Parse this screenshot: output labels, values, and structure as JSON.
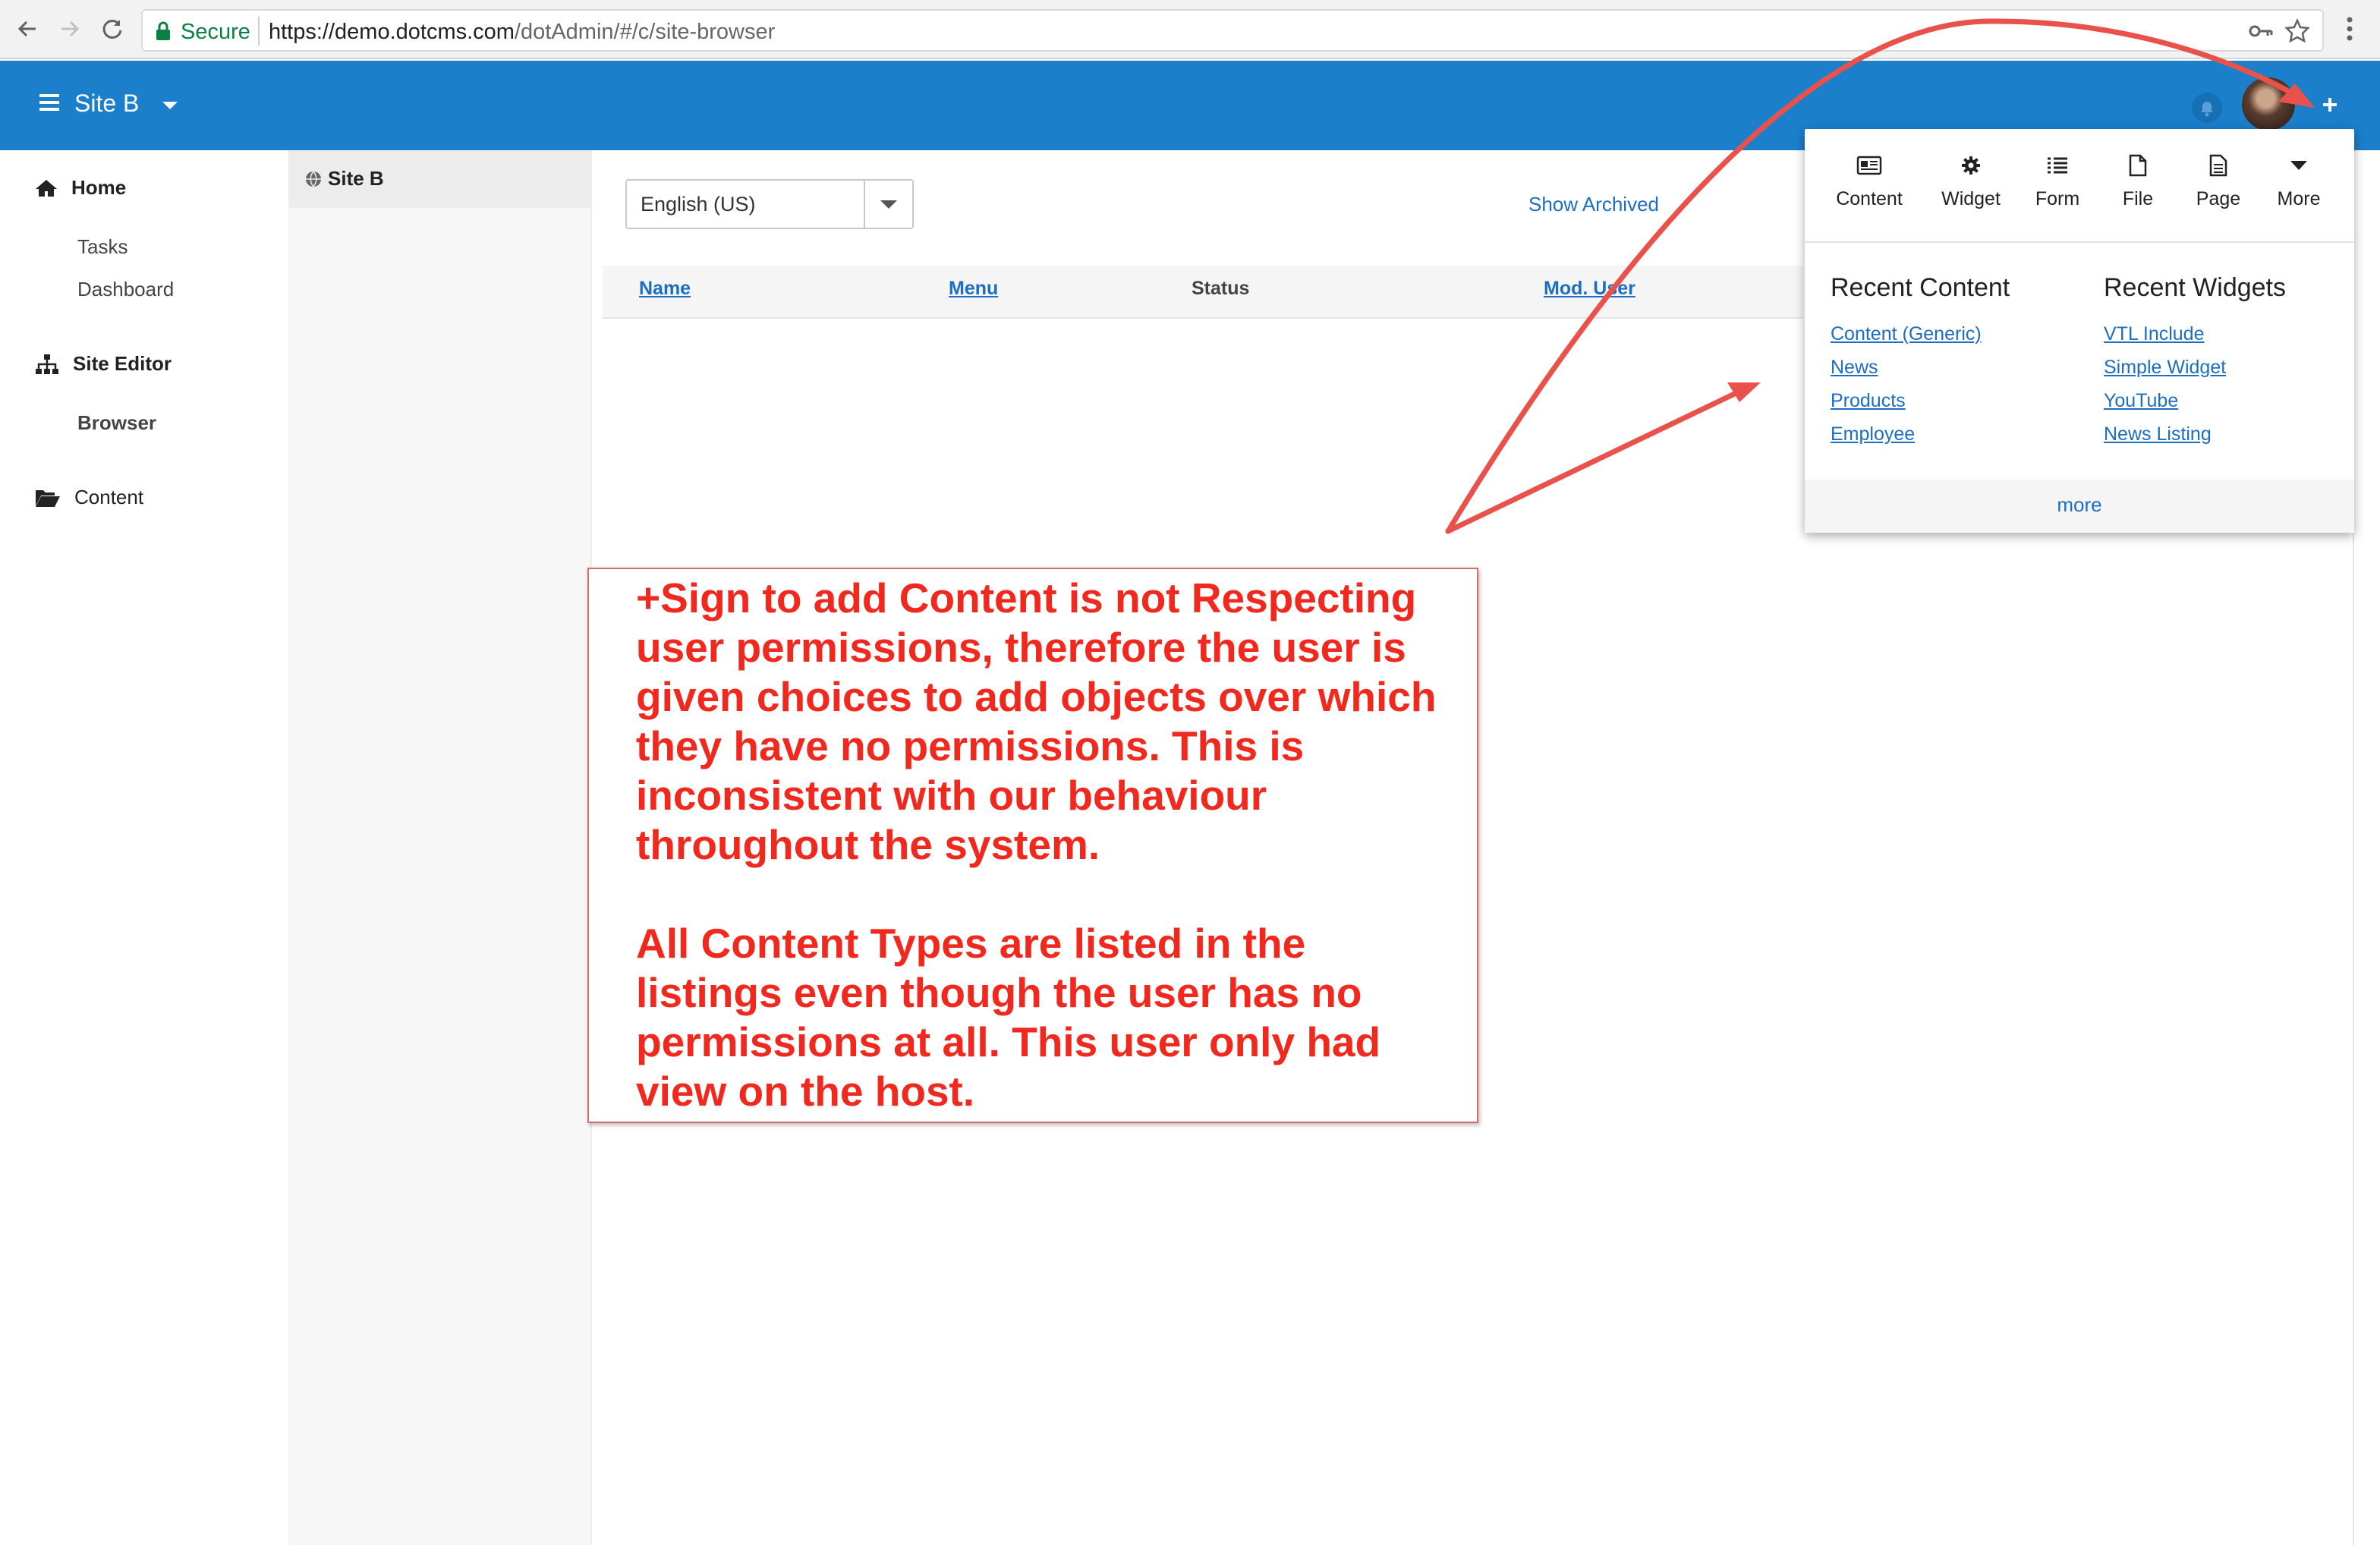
{
  "browser": {
    "secure_label": "Secure",
    "url_host": "https://demo.dotcms.com",
    "url_path": "/dotAdmin/#/c/site-browser"
  },
  "header": {
    "site_name": "Site B"
  },
  "leftnav": {
    "sections": [
      {
        "label": "Home",
        "icon": "home-icon",
        "items": [
          "Tasks",
          "Dashboard"
        ]
      },
      {
        "label": "Site Editor",
        "icon": "sitemap-icon",
        "items": [
          "Browser"
        ]
      },
      {
        "label": "Content",
        "icon": "folder-open-icon",
        "items": []
      }
    ]
  },
  "tree": {
    "root_label": "Site B"
  },
  "browser_panel": {
    "language": "English (US)",
    "show_archived": "Show Archived",
    "columns": [
      "Name",
      "Menu",
      "Status",
      "Mod. User"
    ]
  },
  "add_menu": {
    "types": [
      {
        "label": "Content",
        "icon": "content-icon"
      },
      {
        "label": "Widget",
        "icon": "gear-icon"
      },
      {
        "label": "Form",
        "icon": "list-icon"
      },
      {
        "label": "File",
        "icon": "file-icon"
      },
      {
        "label": "Page",
        "icon": "page-icon"
      },
      {
        "label": "More",
        "icon": "caret-down-icon"
      }
    ],
    "recent_content_title": "Recent Content",
    "recent_content": [
      "Content (Generic)",
      "News",
      "Products",
      "Employee"
    ],
    "recent_widgets_title": "Recent Widgets",
    "recent_widgets": [
      "VTL Include",
      "Simple Widget",
      "YouTube",
      "News Listing"
    ],
    "more_label": "more"
  },
  "annotation": {
    "paragraph1": "+Sign to add Content is not Respecting user permissions, therefore the user is given choices to add objects over which they have no permissions.  This is inconsistent with our behaviour throughout the system.",
    "paragraph2": "All Content Types are listed in the listings even though the user has no permissions at all.  This user only had view on the host.",
    "color": "#f0281d"
  },
  "colors": {
    "header_blue": "#1b7fcc",
    "link_blue": "#1b6ec2"
  }
}
